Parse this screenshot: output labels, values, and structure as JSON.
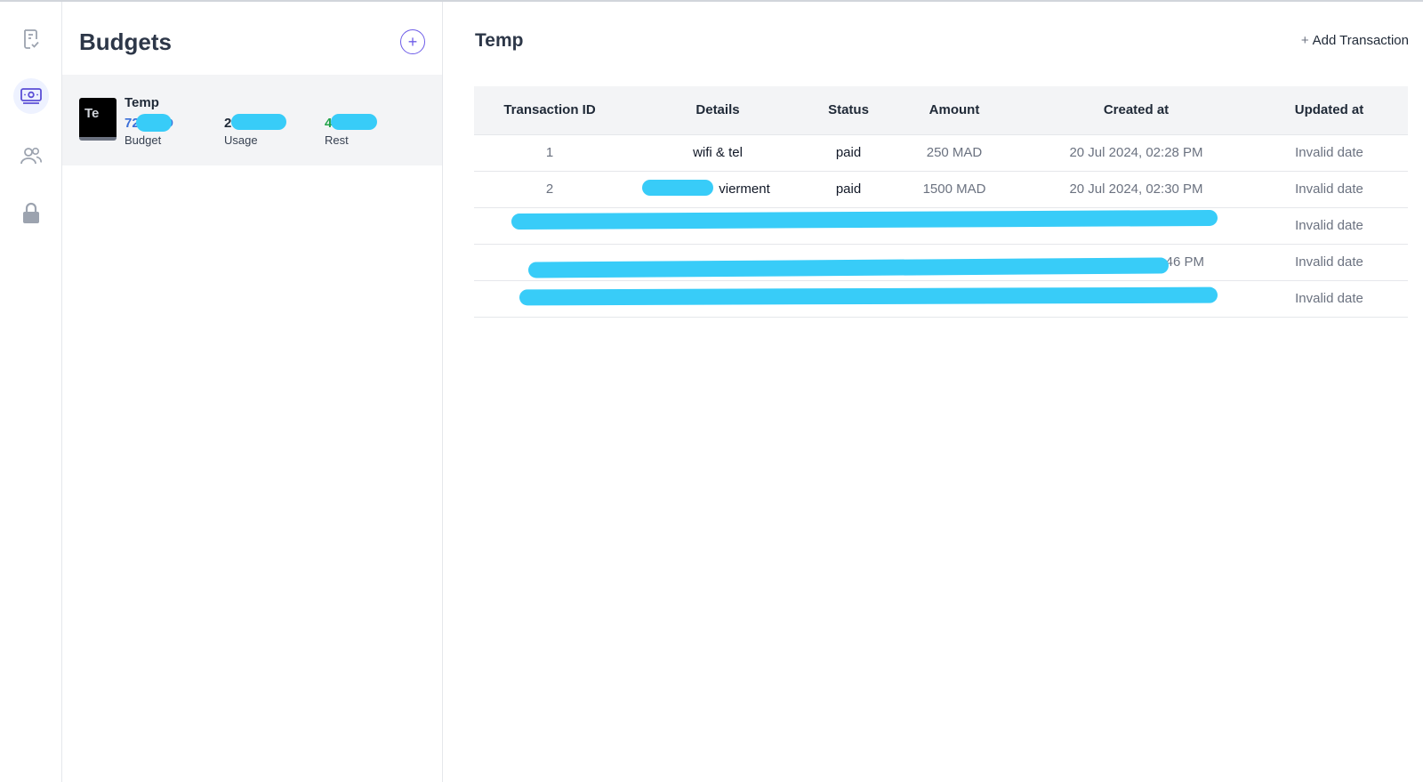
{
  "rail": {
    "items": [
      {
        "icon": "receipt-check-icon",
        "active": false
      },
      {
        "icon": "money-icon",
        "active": true
      },
      {
        "icon": "users-icon",
        "active": false
      },
      {
        "icon": "lock-icon",
        "active": false
      }
    ]
  },
  "budgets": {
    "title": "Budgets",
    "add_icon": "+",
    "card": {
      "avatar_text": "Te",
      "name": "Temp",
      "budget": {
        "value": "72 MAD",
        "label": "Budget",
        "color": "#3b6fd8"
      },
      "usage": {
        "value": "2 AD",
        "label": "Usage",
        "color": "#1f2937"
      },
      "rest": {
        "value": "4 AD",
        "label": "Rest",
        "color": "#22a34a"
      }
    }
  },
  "main": {
    "title": "Temp",
    "add_transaction": {
      "plus": "+",
      "label": "Add Transaction"
    },
    "table": {
      "columns": [
        "Transaction ID",
        "Details",
        "Status",
        "Amount",
        "Created at",
        "Updated at"
      ],
      "rows": [
        {
          "id": "1",
          "details": "wifi & tel",
          "status": "paid",
          "amount": "250 MAD",
          "created": "20 Jul 2024, 02:28 PM",
          "updated": "Invalid date"
        },
        {
          "id": "2",
          "details": "vierment",
          "status": "paid",
          "amount": "1500 MAD",
          "created": "20 Jul 2024, 02:30 PM",
          "updated": "Invalid date"
        },
        {
          "id": "",
          "details": "",
          "status": "",
          "amount": "",
          "created": "",
          "updated": "Invalid date"
        },
        {
          "id": "",
          "details": "",
          "status": "",
          "amount": "",
          "created": ":46 PM",
          "updated": "Invalid date"
        },
        {
          "id": "",
          "details": "",
          "status": "",
          "amount": "",
          "created": "",
          "updated": "Invalid date"
        }
      ]
    }
  },
  "colors": {
    "accent": "#6d5ce8",
    "redaction": "#38ccf8"
  }
}
